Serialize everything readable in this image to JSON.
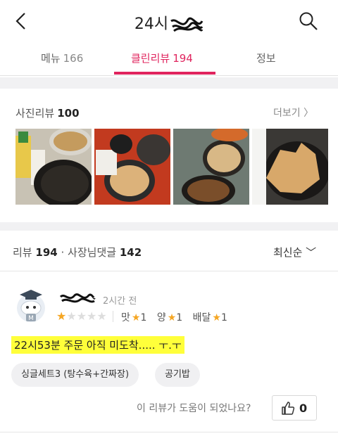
{
  "header": {
    "title": "24시",
    "back_icon": "chevron-left-icon",
    "search_icon": "search-icon"
  },
  "tabs": [
    {
      "label": "메뉴",
      "count": "166",
      "active": false
    },
    {
      "label": "클린리뷰",
      "count": "194",
      "active": true
    },
    {
      "label": "정보",
      "count": "",
      "active": false
    }
  ],
  "accent_color": "#e0245e",
  "photo_reviews": {
    "label": "사진리뷰",
    "count": "100",
    "more_label": "더보기 〉"
  },
  "reviews_bar": {
    "review_label": "리뷰",
    "review_count": "194",
    "separator": "·",
    "owner_reply_label": "사장님댓글",
    "owner_reply_count": "142",
    "sort_label": "최신순 ﹀"
  },
  "review": {
    "time": "2시간 전",
    "rating": 1,
    "star_on": "★",
    "star_off": "★★★★",
    "sub_ratings": [
      {
        "label": "맛",
        "star": "★",
        "value": "1"
      },
      {
        "label": "양",
        "star": "★",
        "value": "1"
      },
      {
        "label": "배달",
        "star": "★",
        "value": "1"
      }
    ],
    "text": "22시53분 주문 아직 미도착..... ㅜ.ㅜ",
    "menu_chips": [
      "싱글세트3 (탕수육+간짜장)",
      "공기밥"
    ],
    "helpful_question": "이 리뷰가 도움이 되었나요?",
    "like_count": "0"
  }
}
